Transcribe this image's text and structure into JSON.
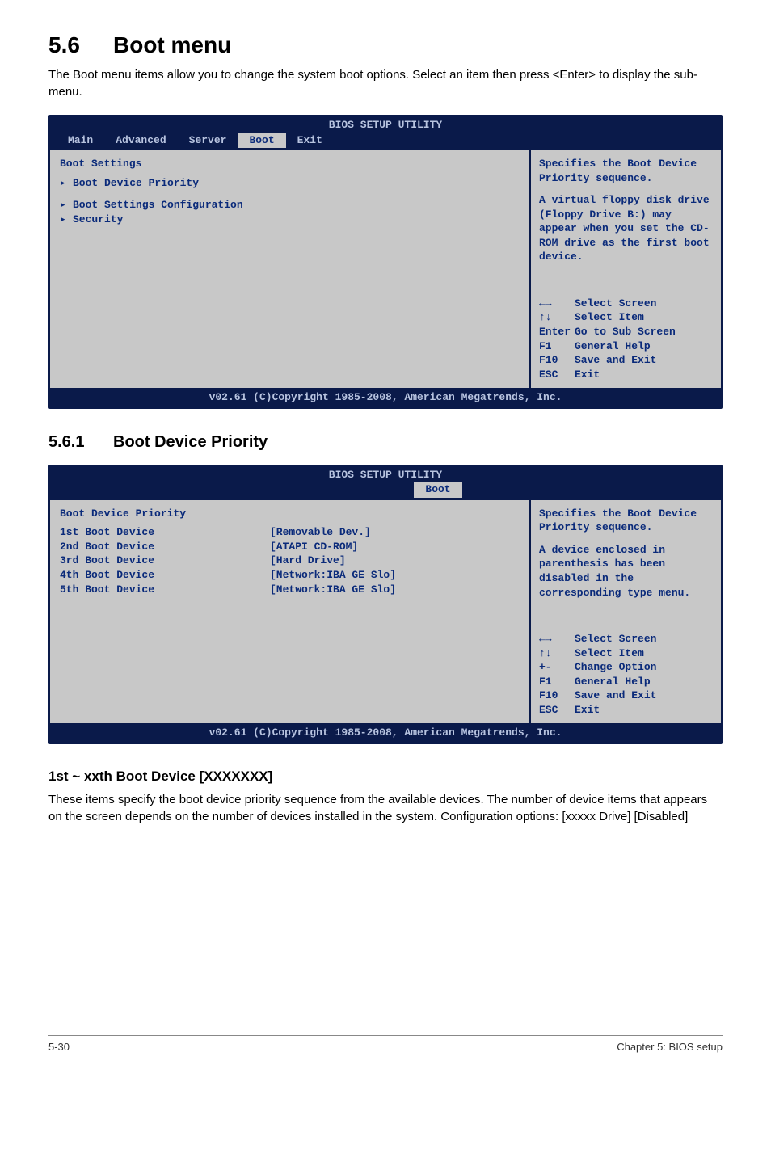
{
  "heading": {
    "num": "5.6",
    "title": "Boot menu"
  },
  "intro": "The Boot menu items allow you to change the system boot options. Select an item then press <Enter> to display the sub-menu.",
  "bios1": {
    "header": "BIOS SETUP UTILITY",
    "tabs": [
      "Main",
      "Advanced",
      "Server",
      "Boot",
      "Exit"
    ],
    "left_title": "Boot Settings",
    "items": [
      "Boot Device Priority",
      "Boot Settings Configuration",
      "Security"
    ],
    "help1": "Specifies the Boot Device Priority sequence.",
    "help2": "A virtual floppy disk drive (Floppy Drive B:) may appear when you set the CD-ROM drive as the first boot device.",
    "keys": [
      {
        "k": "←→",
        "v": "Select Screen"
      },
      {
        "k": "↑↓",
        "v": "Select Item"
      },
      {
        "k": "Enter",
        "v": "Go to Sub Screen"
      },
      {
        "k": "F1",
        "v": "General Help"
      },
      {
        "k": "F10",
        "v": "Save and Exit"
      },
      {
        "k": "ESC",
        "v": "Exit"
      }
    ],
    "footer": "v02.61 (C)Copyright 1985-2008, American Megatrends, Inc."
  },
  "sub": {
    "num": "5.6.1",
    "title": "Boot Device Priority"
  },
  "bios2": {
    "header": "BIOS SETUP UTILITY",
    "tabs": [
      "Boot"
    ],
    "left_title": "Boot Device Priority",
    "rows": [
      {
        "label": "1st Boot Device",
        "val": "[Removable Dev.]"
      },
      {
        "label": "2nd Boot Device",
        "val": "[ATAPI CD-ROM]"
      },
      {
        "label": "3rd Boot Device",
        "val": "[Hard Drive]"
      },
      {
        "label": "4th Boot Device",
        "val": "[Network:IBA GE Slo]"
      },
      {
        "label": "5th Boot Device",
        "val": "[Network:IBA GE Slo]"
      }
    ],
    "help1": "Specifies the Boot Device Priority sequence.",
    "help2": "A device enclosed in parenthesis has been disabled in the corresponding type menu.",
    "keys": [
      {
        "k": "←→",
        "v": "Select Screen"
      },
      {
        "k": "↑↓",
        "v": "Select Item"
      },
      {
        "k": "+-",
        "v": "Change Option"
      },
      {
        "k": "F1",
        "v": "General Help"
      },
      {
        "k": "F10",
        "v": "Save and Exit"
      },
      {
        "k": "ESC",
        "v": "Exit"
      }
    ],
    "footer": "v02.61 (C)Copyright 1985-2008, American Megatrends, Inc."
  },
  "h3": "1st ~ xxth Boot Device [XXXXXXX]",
  "body": "These items specify the boot device priority sequence from the available devices. The number of device items that appears on the screen depends on the number of devices installed in the system. Configuration options: [xxxxx Drive] [Disabled]",
  "footer": {
    "left": "5-30",
    "right": "Chapter 5: BIOS setup"
  }
}
